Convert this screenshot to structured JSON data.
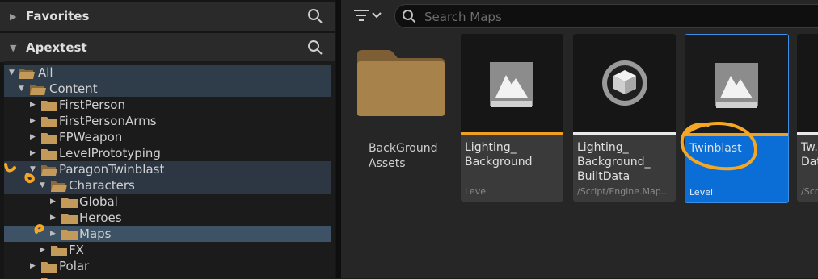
{
  "favorites": {
    "title": "Favorites"
  },
  "project": {
    "title": "Apextest"
  },
  "tree": [
    {
      "label": "All"
    },
    {
      "label": "Content"
    },
    {
      "label": "FirstPerson"
    },
    {
      "label": "FirstPersonArms"
    },
    {
      "label": "FPWeapon"
    },
    {
      "label": "LevelPrototyping"
    },
    {
      "label": "ParagonTwinblast"
    },
    {
      "label": "Characters"
    },
    {
      "label": "Global"
    },
    {
      "label": "Heroes"
    },
    {
      "label": "Maps"
    },
    {
      "label": "FX"
    },
    {
      "label": "Polar"
    }
  ],
  "search": {
    "placeholder": "Search Maps"
  },
  "folder": {
    "label": "BackGround\nAssets"
  },
  "assets": [
    {
      "name": "Lighting_\nBackground",
      "type": "Level",
      "bar_color": "#f0a020",
      "icon": "level-icon"
    },
    {
      "name": "Lighting_\nBackground_\nBuiltData",
      "type": "/Script/Engine.Map...",
      "bar_color": "#e8e8e8",
      "icon": "map-build-data-icon"
    },
    {
      "name": "Twinblast",
      "type": "Level",
      "bar_color": "#f0a020",
      "icon": "level-icon",
      "selected": true
    },
    {
      "name": "Tw...\nDat...",
      "type": "/Scr...",
      "bar_color": "#e8e8e8",
      "icon": "map-build-data-icon"
    }
  ],
  "colors": {
    "accent": "#0a6ed6",
    "annotation": "#f5a623",
    "folder": "#a8824b"
  }
}
